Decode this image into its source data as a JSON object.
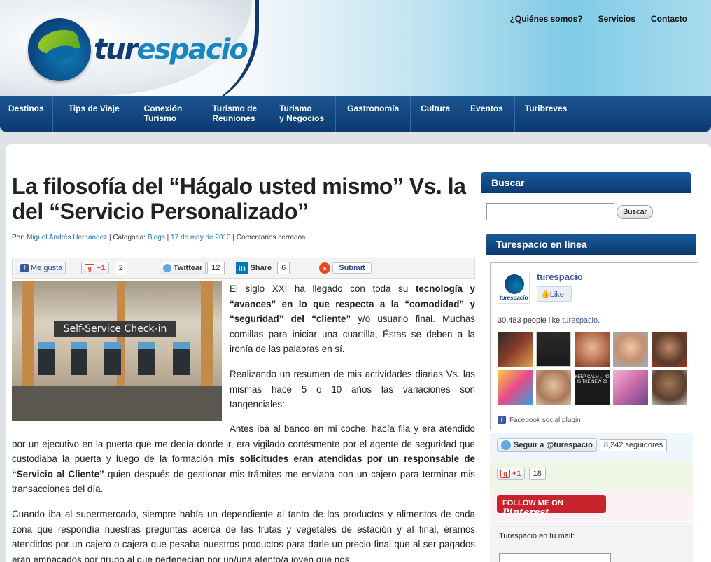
{
  "header": {
    "logo_text_a": "tur",
    "logo_text_b": "espacio",
    "top_nav": [
      "¿Quiénes somos?",
      "Servicios",
      "Contacto"
    ]
  },
  "main_nav": [
    {
      "line1": "Destinos",
      "line2": ""
    },
    {
      "line1": "Tips de Viaje",
      "line2": ""
    },
    {
      "line1": "Conexión",
      "line2": "Turismo"
    },
    {
      "line1": "Turismo de",
      "line2": "Reuniones"
    },
    {
      "line1": "Turismo",
      "line2": "y Negocios"
    },
    {
      "line1": "Gastronomía",
      "line2": ""
    },
    {
      "line1": "Cultura",
      "line2": ""
    },
    {
      "line1": "Eventos",
      "line2": ""
    },
    {
      "line1": "Turibreves",
      "line2": ""
    }
  ],
  "post": {
    "title": "La filosofía del “Hágalo usted mismo” Vs. la del “Servicio Personalizado”",
    "meta_by": "Por: ",
    "author": "Miguel Andrés Hernández",
    "sep1": " | Categoría: ",
    "category": "Blogs",
    "sep2": " | ",
    "date": "17 de may de 2013",
    "sep3": " | Comentarios cerrados",
    "image_sign": "Self-Service Check-in",
    "p1_a": "El siglo XXI ha llegado con toda su ",
    "p1_b": "tecnología y “avances” en lo que respecta a la “comodidad” y “seguridad” del “cliente”",
    "p1_c": " y/o usuario final. Muchas comillas para iniciar una cuartilla, Éstas se deben a la ironía de las palabras en sí.",
    "p2": "Realizando un resumen de mis actividades diarias Vs. las mismas hace 5 o 10 años las variaciones son tangenciales:",
    "p3_a": "Antes iba al banco en mi coche, hacía fila y era atendido por un ejecutivo en la puerta que me decía donde ir, era vigilado cortésmente por el agente de seguridad que custodiaba la puerta y luego de la formación ",
    "p3_b": "mis solicitudes eran atendidas por un responsable de “Servicio al Cliente”",
    "p3_c": " quien después de gestionar mis trámites me enviaba con un cajero para terminar mis transacciones del día.",
    "p4": "Cuando iba al supermercado, siempre había un dependiente al tanto de los productos y alimentos de cada zona que respondía nuestras preguntas acerca de las frutas y vegetales de estación y al final, éramos atendidos por un cajero o cajera que pesaba nuestros productos para darle un precio final que al ser pagados eran empacados por grupo al que pertenecían por un/una atento/a joven que nos"
  },
  "share": {
    "fb_label": "Me gusta",
    "gplus_label": "+1",
    "gplus_count": "2",
    "tw_label": "Twittear",
    "tw_count": "12",
    "li_label": "Share",
    "li_count": "6",
    "su_label": "Submit"
  },
  "sidebar": {
    "search_title": "Buscar",
    "search_button": "Buscar",
    "online_title": "Turespacio en línea",
    "fb_name": "turespacio",
    "fb_like": "Like",
    "fb_logo_mini": "turespacio",
    "fb_count_prefix": "30,483 people like ",
    "fb_count_link": "turespacio",
    "fb_count_suffix": ".",
    "fb_footer": "Facebook social plugin",
    "face_keep_calm": "KEEP CALM ... 40 IS THE NEW 20",
    "tw_follow": "Seguir a @turespacio",
    "tw_followers": "8,242 seguidores",
    "gp_label": "+1",
    "gp_count": "18",
    "pin_prefix": "FOLLOW ME ON",
    "pin_brand": "Pinterest",
    "mail_label": "Turespacio en tu mail:"
  },
  "colors": {
    "nav_blue": "#0c3a70",
    "link_blue": "#1a73b5",
    "fb_blue": "#3b5998",
    "pinterest_red": "#c8232c"
  }
}
